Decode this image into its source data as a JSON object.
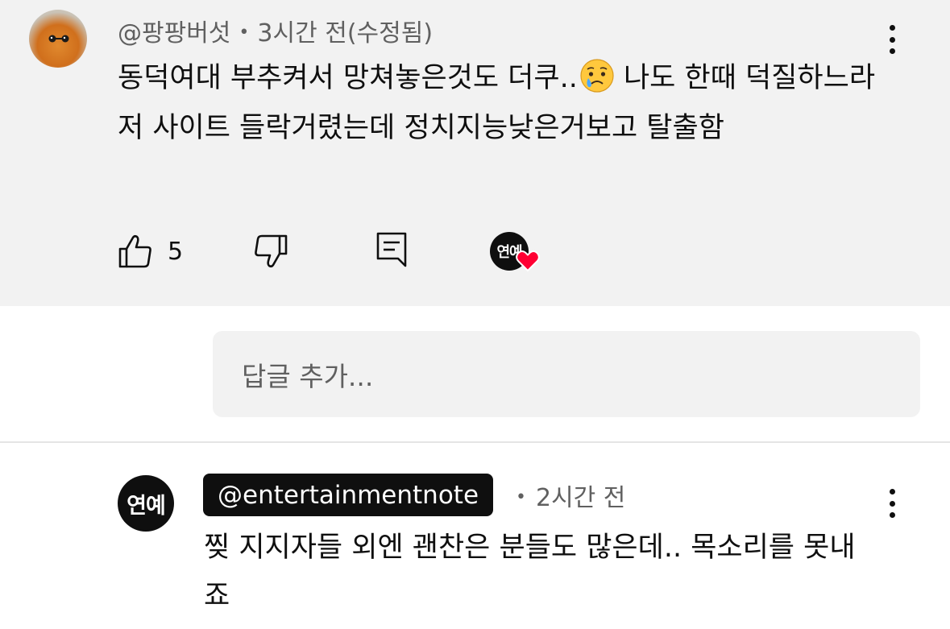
{
  "top_comment": {
    "author": "@팡팡버섯",
    "time": "3시간 전(수정됨)",
    "text_before_emoji": "동덕여대 부추켜서 망쳐놓은것도 더쿠..",
    "emoji": "crying-face",
    "text_after_emoji": " 나도 한때 덕질하느라 저 사이트 들락거렸는데 정치지능낮은거보고 탈출함",
    "like_count": "5",
    "creator_badge_text": "연예",
    "creator_heart_color": "#ff0033"
  },
  "reply_input": {
    "placeholder": "답글 추가..."
  },
  "reply": {
    "avatar_text": "연예",
    "author": "@entertainmentnote",
    "separator": "•",
    "time": "2시간 전",
    "text": "찢 지지자들 외엔 괜찬은 분들도 많은데.. 목소리를 못내죠"
  },
  "colors": {
    "highlight_bg": "#f2f2f2",
    "text_primary": "#0f0f0f",
    "text_secondary": "#606060"
  }
}
